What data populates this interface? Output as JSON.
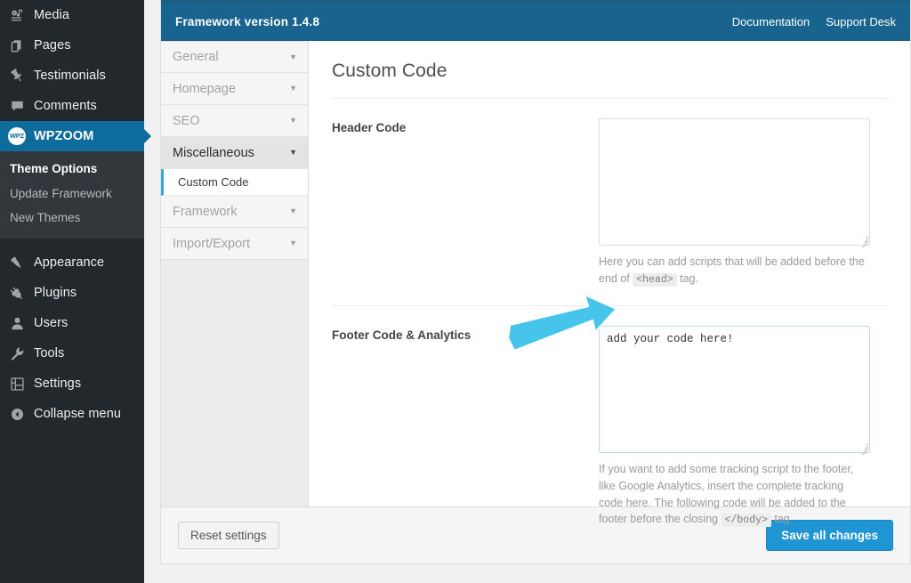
{
  "admin_menu": {
    "items": [
      {
        "label": "Media",
        "icon": "media-icon",
        "current": false
      },
      {
        "label": "Pages",
        "icon": "pages-icon",
        "current": false
      },
      {
        "label": "Testimonials",
        "icon": "pin-icon",
        "current": false
      },
      {
        "label": "Comments",
        "icon": "comment-icon",
        "current": false
      },
      {
        "label": "WPZOOM",
        "icon": "wpzoom-logo-icon",
        "current": true
      }
    ],
    "submenu": [
      {
        "label": "Theme Options",
        "current": true
      },
      {
        "label": "Update Framework",
        "current": false
      },
      {
        "label": "New Themes",
        "current": false
      }
    ],
    "items_lower": [
      {
        "label": "Appearance",
        "icon": "paintbrush-icon"
      },
      {
        "label": "Plugins",
        "icon": "plug-icon"
      },
      {
        "label": "Users",
        "icon": "user-icon"
      },
      {
        "label": "Tools",
        "icon": "wrench-icon"
      },
      {
        "label": "Settings",
        "icon": "sliders-icon"
      },
      {
        "label": "Collapse menu",
        "icon": "collapse-arrow-icon"
      }
    ],
    "wpzoom_logo_text": "WPZ"
  },
  "topbar": {
    "title": "Framework version 1.4.8",
    "links": [
      {
        "label": "Documentation"
      },
      {
        "label": "Support Desk"
      }
    ]
  },
  "tabs": [
    {
      "label": "General",
      "active": false,
      "caret": "▼"
    },
    {
      "label": "Homepage",
      "active": false,
      "caret": "▼"
    },
    {
      "label": "SEO",
      "active": false,
      "caret": "▼"
    },
    {
      "label": "Miscellaneous",
      "active": true,
      "caret": "▼"
    },
    {
      "label": "Framework",
      "active": false,
      "caret": "▼"
    },
    {
      "label": "Import/Export",
      "active": false,
      "caret": "▼"
    }
  ],
  "subtabs": [
    {
      "label": "Custom Code",
      "active": true
    }
  ],
  "content": {
    "title": "Custom Code",
    "fields": [
      {
        "label": "Header Code",
        "value": "",
        "focused": false,
        "help_before": "Here you can add scripts that will be added before the end of ",
        "help_code": "<head>",
        "help_after": " tag."
      },
      {
        "label": "Footer Code & Analytics",
        "value": "add your code here!",
        "focused": true,
        "help_before": "If you want to add some tracking script to the footer, like Google Analytics, insert the complete tracking code here. The following code will be added to the footer before the closing ",
        "help_code": "</body>",
        "help_after": " tag."
      }
    ]
  },
  "footer": {
    "reset_label": "Reset settings",
    "save_label": "Save all changes"
  },
  "annotation": {
    "name": "arrow-annotation",
    "color": "#46c4e9",
    "outline": "#ffffff"
  },
  "colors": {
    "admin_bg": "#23282d",
    "admin_current": "#0d6c9c",
    "topbar_blue": "#19648f",
    "save_blue": "#2095d4",
    "subtab_accent": "#35a6de"
  }
}
